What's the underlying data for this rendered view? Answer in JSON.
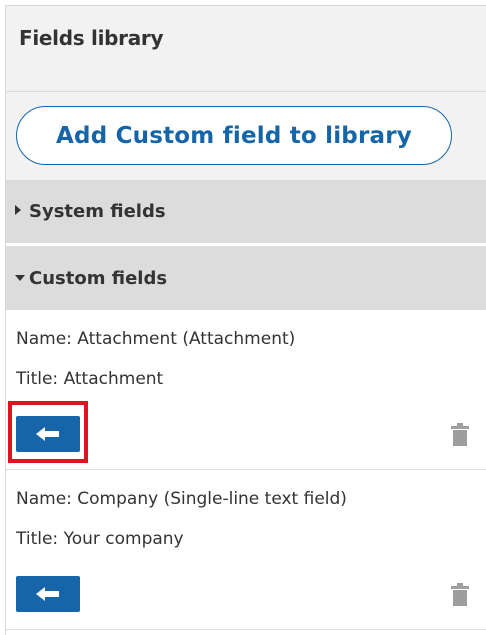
{
  "header": {
    "title": "Fields library"
  },
  "add_button": {
    "label": "Add Custom field to library"
  },
  "sections": [
    {
      "label": "System fields",
      "expanded": false
    },
    {
      "label": "Custom fields",
      "expanded": true
    }
  ],
  "custom_fields": [
    {
      "name": "Name: Attachment (Attachment)",
      "title": "Title: Attachment"
    },
    {
      "name": "Name: Company (Single-line text field)",
      "title": "Title: Your company"
    }
  ],
  "icons": {
    "move": "arrow-left-icon",
    "delete": "trash-icon",
    "collapsed": "caret-right-icon",
    "expanded": "caret-down-icon"
  },
  "colors": {
    "accent": "#1565a8",
    "highlight": "#e1121f",
    "trash": "#9e9e9e"
  }
}
